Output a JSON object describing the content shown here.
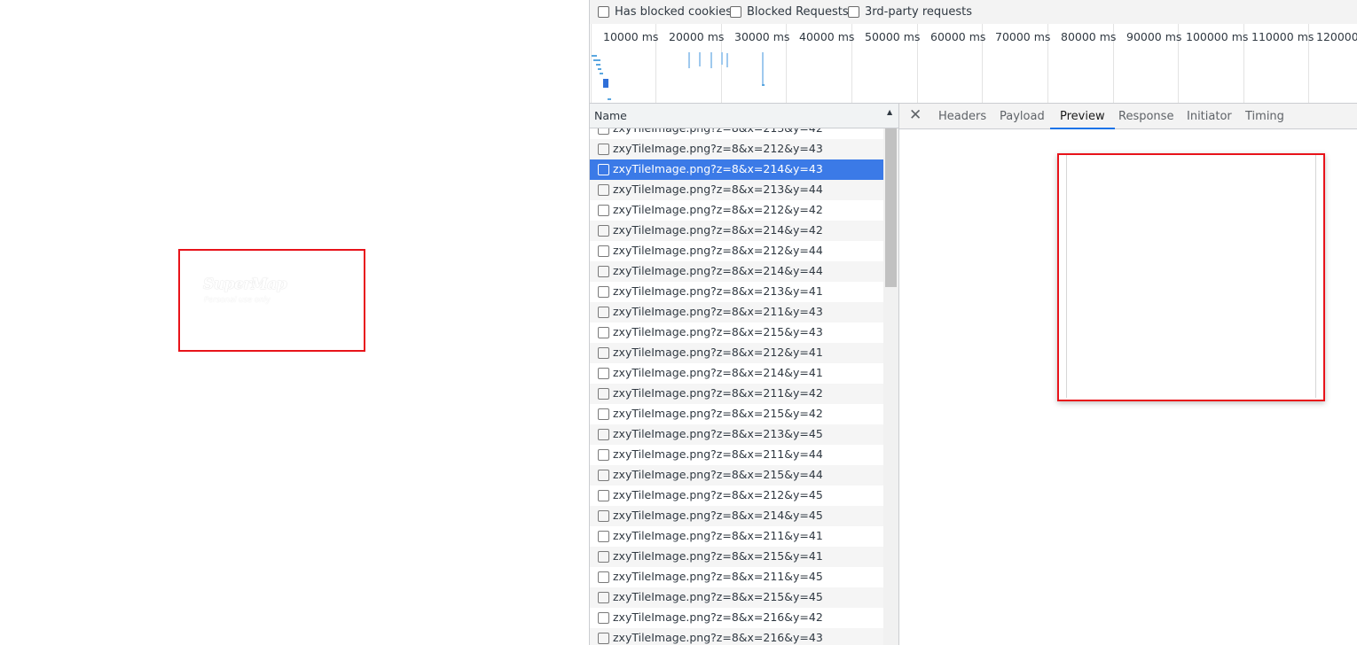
{
  "page": {
    "watermark_brand": "SuperMap",
    "watermark_note": "Personal use only"
  },
  "devtools": {
    "filters": [
      {
        "label": "Has blocked cookies",
        "checked": false
      },
      {
        "label": "Blocked Requests",
        "checked": false
      },
      {
        "label": "3rd-party requests",
        "checked": false
      }
    ],
    "timeline_ticks": [
      "10000 ms",
      "20000 ms",
      "30000 ms",
      "40000 ms",
      "50000 ms",
      "60000 ms",
      "70000 ms",
      "80000 ms",
      "90000 ms",
      "100000 ms",
      "110000 ms",
      "120000"
    ],
    "request_list": {
      "column_header": "Name",
      "partial_top_row": "zxyTileImage.png?z=8&x=213&y=42",
      "rows": [
        "zxyTileImage.png?z=8&x=212&y=43",
        "zxyTileImage.png?z=8&x=214&y=43",
        "zxyTileImage.png?z=8&x=213&y=44",
        "zxyTileImage.png?z=8&x=212&y=42",
        "zxyTileImage.png?z=8&x=214&y=42",
        "zxyTileImage.png?z=8&x=212&y=44",
        "zxyTileImage.png?z=8&x=214&y=44",
        "zxyTileImage.png?z=8&x=213&y=41",
        "zxyTileImage.png?z=8&x=211&y=43",
        "zxyTileImage.png?z=8&x=215&y=43",
        "zxyTileImage.png?z=8&x=212&y=41",
        "zxyTileImage.png?z=8&x=214&y=41",
        "zxyTileImage.png?z=8&x=211&y=42",
        "zxyTileImage.png?z=8&x=215&y=42",
        "zxyTileImage.png?z=8&x=213&y=45",
        "zxyTileImage.png?z=8&x=211&y=44",
        "zxyTileImage.png?z=8&x=215&y=44",
        "zxyTileImage.png?z=8&x=212&y=45",
        "zxyTileImage.png?z=8&x=214&y=45",
        "zxyTileImage.png?z=8&x=211&y=41",
        "zxyTileImage.png?z=8&x=215&y=41",
        "zxyTileImage.png?z=8&x=211&y=45",
        "zxyTileImage.png?z=8&x=215&y=45",
        "zxyTileImage.png?z=8&x=216&y=42",
        "zxyTileImage.png?z=8&x=216&y=43"
      ],
      "selected_index": 1
    },
    "detail_tabs": [
      "Headers",
      "Payload",
      "Preview",
      "Response",
      "Initiator",
      "Timing"
    ],
    "active_tab": "Preview",
    "icons": {
      "close": "close-icon",
      "sort": "sort-ascending-icon"
    },
    "colors": {
      "selected_row": "#3b7ae7",
      "active_tab_underline": "#1a73e8",
      "highlight_frame": "#e8131a"
    }
  }
}
